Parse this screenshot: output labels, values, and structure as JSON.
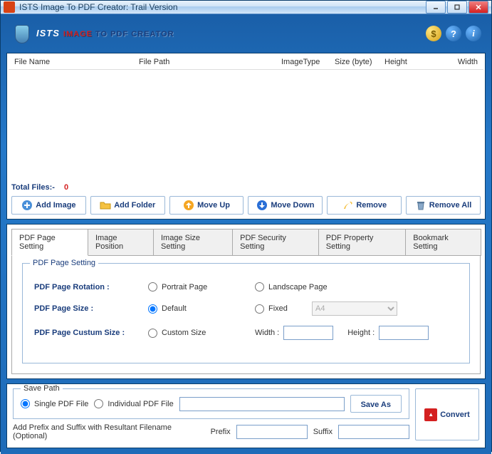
{
  "window": {
    "title": "ISTS Image To PDF Creator: Trail Version"
  },
  "logo": {
    "ists": "ISTS",
    "image": "IMAGE",
    "to_pdf": " TO PDF CREATOR"
  },
  "header_icons": {
    "buy": "$",
    "help": "?",
    "info": "i"
  },
  "file_list": {
    "columns": {
      "file_name": "File Name",
      "file_path": "File Path",
      "image_type": "ImageType",
      "size": "Size (byte)",
      "height": "Height",
      "width": "Width"
    },
    "total_label": "Total Files:-",
    "total_count": "0"
  },
  "toolbar": {
    "add_image": "Add Image",
    "add_folder": "Add Folder",
    "move_up": "Move Up",
    "move_down": "Move Down",
    "remove": "Remove",
    "remove_all": "Remove All"
  },
  "tabs": {
    "page_setting": "PDF Page Setting",
    "image_position": "Image Position",
    "image_size": "Image Size Setting",
    "security": "PDF Security Setting",
    "property": "PDF Property Setting",
    "bookmark": "Bookmark Setting"
  },
  "page_setting": {
    "legend": "PDF Page Setting",
    "rotation_label": "PDF Page Rotation :",
    "portrait": "Portrait Page",
    "landscape": "Landscape Page",
    "size_label": "PDF Page Size :",
    "default": "Default",
    "fixed": "Fixed",
    "fixed_option": "A4",
    "custom_label": "PDF Page Custum Size :",
    "custom_size": "Custom Size",
    "width_label": "Width :",
    "height_label": "Height :"
  },
  "save": {
    "legend": "Save Path",
    "single": "Single PDF File",
    "individual": "Individual PDF File",
    "save_as": "Save As",
    "prefix_text": "Add Prefix and Suffix with Resultant Filename (Optional)",
    "prefix_label": "Prefix",
    "suffix_label": "Suffix",
    "convert": "Convert"
  }
}
